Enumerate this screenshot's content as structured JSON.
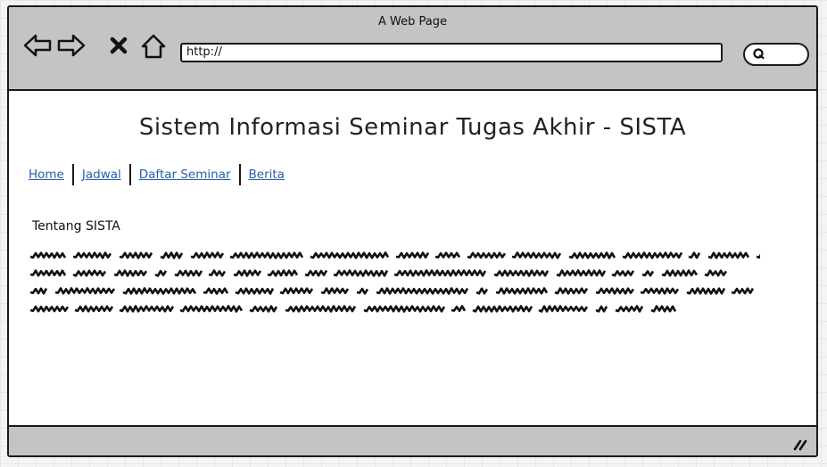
{
  "window": {
    "title": "A Web Page"
  },
  "browser": {
    "url": "http://",
    "icons": [
      "back-icon",
      "forward-icon",
      "stop-icon",
      "home-icon",
      "search-icon",
      "resize-grip-icon"
    ]
  },
  "page": {
    "title": "Sistem Informasi Seminar Tugas Akhir - SISTA",
    "nav": [
      {
        "label": "Home"
      },
      {
        "label": "Jadwal"
      },
      {
        "label": "Daftar Seminar"
      },
      {
        "label": "Berita"
      }
    ],
    "section_title": "Tentang SISTA"
  },
  "colors": {
    "chrome": "#c4c4c4",
    "link": "#2a5da8",
    "border": "#1a1a1a",
    "grid_background": "#f4f4f4"
  }
}
